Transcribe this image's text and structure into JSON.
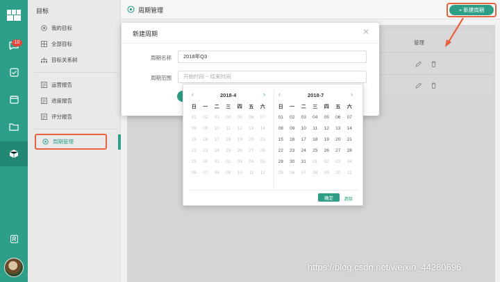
{
  "rail": {
    "badge_count": "10",
    "accent": "#2d9f88"
  },
  "sidebar": {
    "title": "目标",
    "items": [
      {
        "label": "我的目标",
        "icon": "target-icon"
      },
      {
        "label": "全部目标",
        "icon": "grid-icon"
      },
      {
        "label": "目标关系树",
        "icon": "tree-icon"
      },
      {
        "label": "运营报告",
        "icon": "report-icon"
      },
      {
        "label": "进度报告",
        "icon": "report-icon"
      },
      {
        "label": "评分报告",
        "icon": "report-icon"
      },
      {
        "label": "周期管理",
        "icon": "gear-icon"
      }
    ]
  },
  "topbar": {
    "title": "周期管理",
    "new_button": "+ 新建周期"
  },
  "table": {
    "col_manage": "管理"
  },
  "modal": {
    "title": "新建周期",
    "name_label": "周期名称",
    "name_value": "2018年Q3",
    "range_label": "周期范围",
    "range_placeholder": "开始时间 ~ 结束时间"
  },
  "datepicker": {
    "weekdays": [
      "日",
      "一",
      "二",
      "三",
      "四",
      "五",
      "六"
    ],
    "left_month": "2018-4",
    "right_month": "2018-7",
    "left_days": [
      [
        "01",
        "02",
        "03",
        "04",
        "05",
        "06",
        "07"
      ],
      [
        "08",
        "09",
        "10",
        "11",
        "12",
        "13",
        "14"
      ],
      [
        "15",
        "16",
        "17",
        "18",
        "19",
        "20",
        "21"
      ],
      [
        "22",
        "23",
        "24",
        "25",
        "26",
        "27",
        "28"
      ],
      [
        "29",
        "30",
        "01",
        "02",
        "03",
        "04",
        "05"
      ],
      [
        "06",
        "07",
        "08",
        "09",
        "10",
        "11",
        "12"
      ]
    ],
    "right_days": [
      [
        "01",
        "02",
        "03",
        "04",
        "05",
        "06",
        "07"
      ],
      [
        "08",
        "09",
        "10",
        "11",
        "12",
        "13",
        "14"
      ],
      [
        "15",
        "16",
        "17",
        "18",
        "19",
        "20",
        "21"
      ],
      [
        "22",
        "23",
        "24",
        "25",
        "26",
        "27",
        "28"
      ],
      [
        "29",
        "30",
        "31",
        "01",
        "02",
        "03",
        "04"
      ],
      [
        "05",
        "06",
        "07",
        "08",
        "09",
        "10",
        "11"
      ]
    ],
    "confirm": "确定",
    "clear": "清除"
  },
  "watermark": "https://blog.csdn.net/weixin_44280696"
}
